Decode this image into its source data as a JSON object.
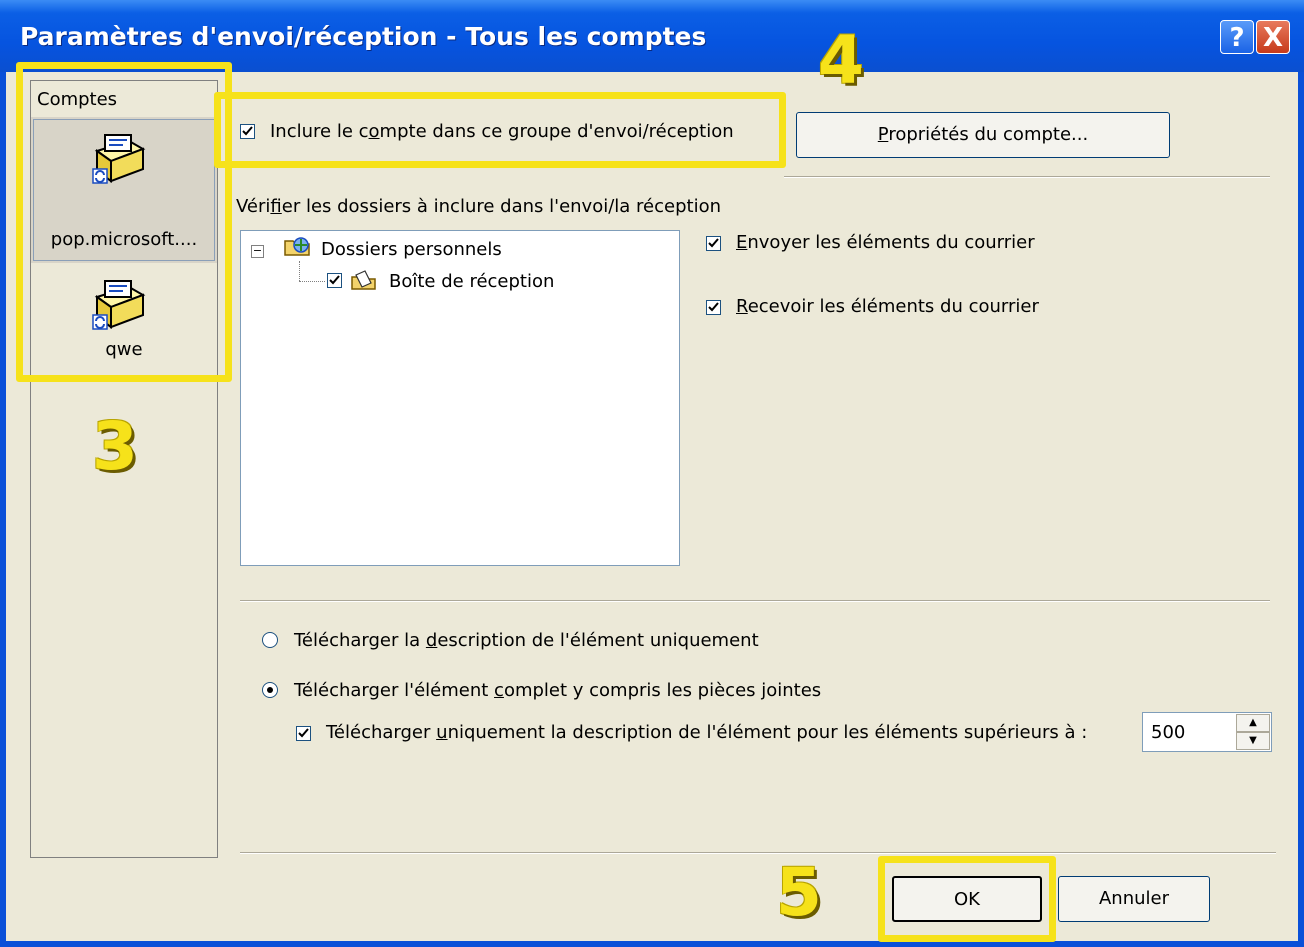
{
  "window": {
    "title": "Paramètres d'envoi/réception - Tous les comptes",
    "help_label": "?",
    "close_label": "X"
  },
  "accounts": {
    "heading": "Comptes",
    "items": [
      {
        "label": "pop.microsoft....",
        "icon": "mailbox-account-icon",
        "selected": true
      },
      {
        "label": "qwe",
        "icon": "mailbox-account-icon",
        "selected": false
      }
    ]
  },
  "include": {
    "label_pre": "Inclure le c",
    "label_u": "o",
    "label_post": "mpte dans ce groupe d'envoi/réception",
    "checked": true
  },
  "properties_button": {
    "label_u": "P",
    "label_post": "ropriétés du compte..."
  },
  "folders": {
    "label_pre": "Véri",
    "label_u": "f",
    "label_post": "ier les dossiers à inclure dans l'envoi/la réception",
    "tree": [
      {
        "label": "Dossiers personnels",
        "icon": "personal-folders-icon",
        "expanded": true
      },
      {
        "label": "Boîte de réception",
        "icon": "inbox-folder-icon",
        "checked": true
      }
    ]
  },
  "send_items": {
    "label_u": "E",
    "label_post": "nvoyer les éléments du courrier",
    "checked": true
  },
  "receive_items": {
    "label_u": "R",
    "label_post": "ecevoir les éléments du courrier",
    "checked": true
  },
  "download": {
    "option_headers": {
      "label_pre": "Télécharger la ",
      "label_u": "d",
      "label_post": "escription de l'élément uniquement",
      "selected": false
    },
    "option_full": {
      "label_pre": "Télécharger l'élément ",
      "label_u": "c",
      "label_post": "omplet y compris les pièces jointes",
      "selected": true
    },
    "limit": {
      "label_pre": "Télécharger ",
      "label_u": "u",
      "label_post": "niquement la description de l'élément pour les éléments supérieurs à :",
      "checked": true,
      "value": "500"
    }
  },
  "buttons": {
    "ok": "OK",
    "cancel": "Annuler"
  },
  "annotations": [
    "3",
    "4",
    "5"
  ],
  "colors": {
    "highlight": "#f6e21a",
    "titlebar": "#0654e0",
    "dialog_bg": "#ece9d8"
  }
}
